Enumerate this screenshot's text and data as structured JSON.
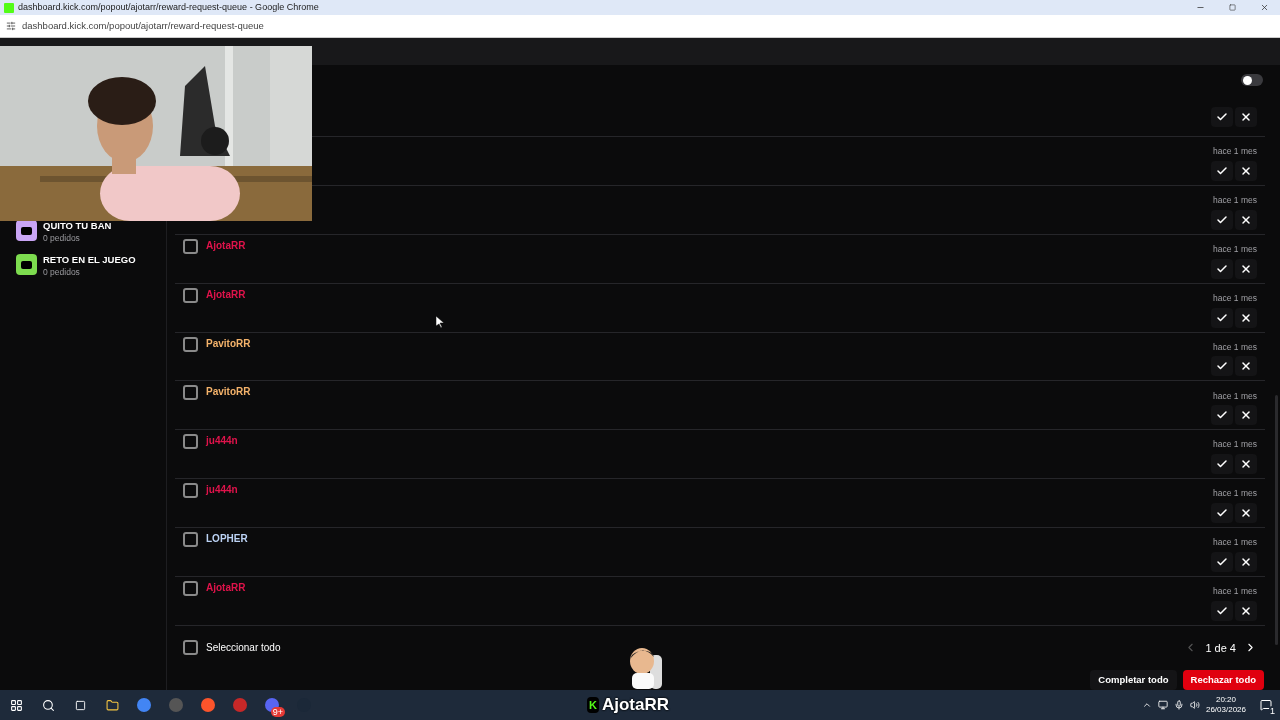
{
  "browser": {
    "title": "dashboard.kick.com/popout/ajotarr/reward-request-queue - Google Chrome",
    "url": "dashboard.kick.com/popout/ajotarr/reward-request-queue"
  },
  "header": {
    "toggle_on": false
  },
  "rewards": [
    {
      "name": "QUITO TU BAN",
      "count": "0 pedidos",
      "color": "#c9a5f5"
    },
    {
      "name": "RETO EN EL JUEGO",
      "count": "0 pedidos",
      "color": "#7ddc4f"
    }
  ],
  "requests": [
    {
      "kind": "partial"
    },
    {
      "time": "hace 1 mes"
    },
    {
      "time": "hace 1 mes"
    },
    {
      "user": "AjotaRR",
      "color": "#e0134b",
      "checked": false,
      "time": "hace 1 mes"
    },
    {
      "user": "AjotaRR",
      "color": "#e0134b",
      "checked": false,
      "time": "hace 1 mes"
    },
    {
      "user": "PavitoRR",
      "color": "#f5b36b",
      "checked": false,
      "time": "hace 1 mes"
    },
    {
      "user": "PavitoRR",
      "color": "#f5b36b",
      "checked": false,
      "time": "hace 1 mes"
    },
    {
      "user": "ju444n",
      "color": "#e0134b",
      "checked": false,
      "time": "hace 1 mes"
    },
    {
      "user": "ju444n",
      "color": "#e0134b",
      "checked": false,
      "time": "hace 1 mes"
    },
    {
      "user": "LOPHER",
      "color": "#bcd3f5",
      "checked": false,
      "time": "hace 1 mes"
    },
    {
      "user": "AjotaRR",
      "color": "#e0134b",
      "checked": false,
      "time": "hace 1 mes"
    }
  ],
  "footer": {
    "select_all": {
      "label": "Seleccionar todo",
      "checked": false
    },
    "page": "1 de 4",
    "buttons": [
      "Completar todo",
      "Rechazar todo"
    ]
  },
  "overlay": {
    "badge": "K",
    "logo_text": "AjotaRR"
  },
  "taskbar": {
    "discord_badge": "9+",
    "time": "20:20",
    "date": "26/03/2026",
    "notifications": "1"
  }
}
